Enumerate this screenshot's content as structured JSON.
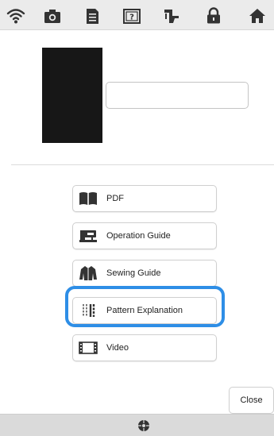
{
  "toolbar": {
    "icons": [
      "wifi-icon",
      "camera-icon",
      "document-icon",
      "help-icon",
      "sewing-machine-icon",
      "lock-icon",
      "home-icon"
    ]
  },
  "preview": {
    "color": "#171717"
  },
  "name_field": {
    "value": ""
  },
  "menu": {
    "items": [
      {
        "label": "PDF",
        "icon": "book-icon"
      },
      {
        "label": "Operation Guide",
        "icon": "sewing-machine-icon"
      },
      {
        "label": "Sewing Guide",
        "icon": "garment-icon"
      },
      {
        "label": "Pattern Explanation",
        "icon": "stitch-pattern-icon",
        "highlighted": true
      },
      {
        "label": "Video",
        "icon": "film-icon"
      }
    ]
  },
  "close_label": "Close",
  "bottombar": {
    "icon": "thread-spool-icon"
  },
  "colors": {
    "highlight": "#2e8ee6",
    "toolbar_bg": "#ebebeb",
    "bottombar_bg": "#dadada"
  }
}
